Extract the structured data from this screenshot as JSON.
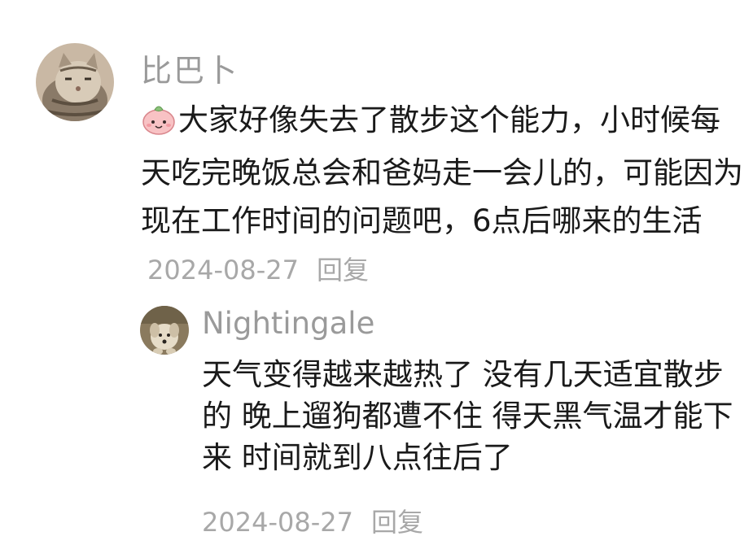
{
  "main_comment": {
    "username": "比巴卜",
    "avatar_icon": "cat-avatar",
    "emoji_icon": "peach-emoji",
    "text": "大家好像失去了散步这个能力，小时候每天吃完晚饭总会和爸妈走一会儿的，可能因为现在工作时间的问题吧，6点后哪来的生活",
    "date": "2024-08-27",
    "reply_label": "回复"
  },
  "reply_comment": {
    "username": "Nightingale",
    "avatar_icon": "dog-avatar",
    "text": "天气变得越来越热了 没有几天适宜散步的 晚上遛狗都遭不住 得天黑气温才能下来 时间就到八点往后了",
    "date": "2024-08-27",
    "reply_label": "回复"
  },
  "colors": {
    "username": "#9a9a9a",
    "text": "#1a1a1a",
    "meta": "#a8a8a8"
  }
}
